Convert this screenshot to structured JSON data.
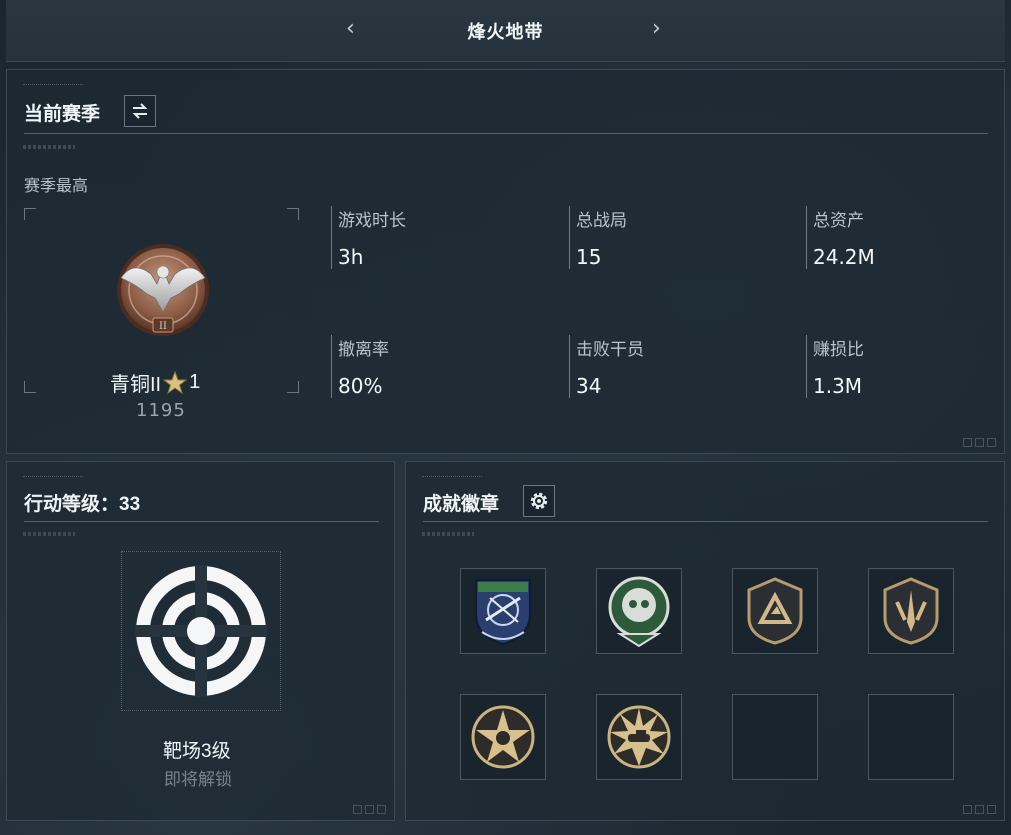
{
  "header": {
    "title": "烽火地带",
    "prev_arrow": "‹",
    "next_arrow": "›"
  },
  "season": {
    "title": "当前赛季",
    "switch_icon": "swap-icon",
    "best_label": "赛季最高",
    "rank": {
      "name": "青铜II",
      "stars": "1",
      "score": "1195",
      "tier_numeral": "II"
    },
    "stats": [
      {
        "label": "游戏时长",
        "value": "3h"
      },
      {
        "label": "总战局",
        "value": "15"
      },
      {
        "label": "总资产",
        "value": "24.2M"
      },
      {
        "label": "撤离率",
        "value": "80%"
      },
      {
        "label": "击败干员",
        "value": "34"
      },
      {
        "label": "赚损比",
        "value": "1.3M"
      }
    ]
  },
  "action_level": {
    "title": "行动等级：33",
    "range_name": "靶场3级",
    "range_status": "即将解锁"
  },
  "achievements": {
    "title": "成就徽章",
    "settings_icon": "gear-icon",
    "badges": [
      {
        "icon": "shield-rifle-badge-icon"
      },
      {
        "icon": "skull-badge-icon"
      },
      {
        "icon": "triangle-shield-badge-icon"
      },
      {
        "icon": "dagger-shield-badge-icon"
      },
      {
        "icon": "star-skull-medal-icon"
      },
      {
        "icon": "star-tank-medal-icon"
      },
      {
        "icon": "empty-slot"
      },
      {
        "icon": "empty-slot"
      }
    ]
  },
  "colors": {
    "bronze": "#9a6a52",
    "accent_text": "#f2f5f7",
    "muted_text": "#77838b"
  }
}
